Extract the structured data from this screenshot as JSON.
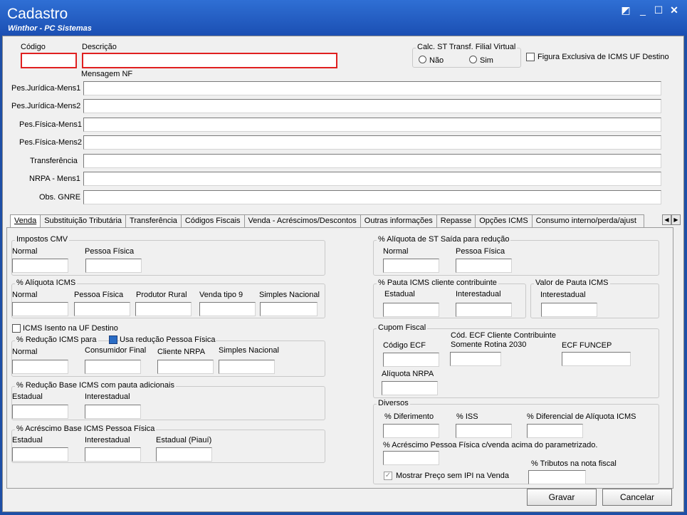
{
  "window": {
    "title": "Cadastro",
    "subtitle": "Winthor - PC Sistemas"
  },
  "top": {
    "codigo_label": "Código",
    "descricao_label": "Descrição",
    "mensagem_label": "Mensagem NF",
    "calc_group": "Calc. ST Transf. Filial Virtual",
    "radio_nao": "Não",
    "radio_sim": "Sim",
    "figura_label": "Figura Exclusiva de ICMS UF Destino",
    "fields": [
      "Pes.Jurídica-Mens1",
      "Pes.Jurídica-Mens2",
      "Pes.Física-Mens1",
      "Pes.Física-Mens2",
      "Transferência",
      "NRPA - Mens1",
      "Obs. GNRE"
    ]
  },
  "tabs": [
    "Venda",
    "Substituição Tributária",
    "Transferência",
    "Códigos Fiscais",
    "Venda - Acréscimos/Descontos",
    "Outras informações",
    "Repasse",
    "Opções ICMS",
    "Consumo interno/perda/ajust"
  ],
  "left": {
    "impostos": {
      "title": "Impostos CMV",
      "normal": "Normal",
      "pf": "Pessoa Física"
    },
    "aliq": {
      "title": "% Alíquota ICMS",
      "cols": [
        "Normal",
        "Pessoa Física",
        "Produtor Rural",
        "Venda tipo 9",
        "Simples Nacional"
      ]
    },
    "isento": "ICMS Isento na UF Destino",
    "reducao": {
      "title": "% Redução ICMS para",
      "usa": "Usa redução Pessoa Física",
      "cols": [
        "Normal",
        "Consumidor Final",
        "Cliente NRPA",
        "Simples Nacional"
      ]
    },
    "base": {
      "title": "% Redução Base ICMS com pauta adicionais",
      "cols": [
        "Estadual",
        "Interestadual"
      ]
    },
    "acres": {
      "title": "% Acréscimo Base ICMS Pessoa Física",
      "cols": [
        "Estadual",
        "Interestadual",
        "Estadual (Piauí)"
      ]
    }
  },
  "right": {
    "st": {
      "title": "% Alíquota de ST Saída para redução",
      "normal": "Normal",
      "pf": "Pessoa Física"
    },
    "pauta": {
      "title": "% Pauta ICMS cliente contribuinte",
      "estadual": "Estadual",
      "inter": "Interestadual"
    },
    "valor": {
      "title": "Valor de Pauta ICMS",
      "inter": "Interestadual"
    },
    "cupom": {
      "title": "Cupom Fiscal",
      "ecf": "Código ECF",
      "cod1": "Cód. ECF Cliente Contribuinte",
      "cod2": "Somente Rotina 2030",
      "funcep": "ECF FUNCEP",
      "nrpa": "Alíquota NRPA"
    },
    "diversos": {
      "title": "Diversos",
      "dif": "% Diferimento",
      "iss": "% ISS",
      "difal": "% Diferencial de Alíquota ICMS",
      "acres": "% Acréscimo Pessoa Física c/venda acima do parametrizado.",
      "trib": "% Tributos na nota fiscal",
      "mostrar": "Mostrar Preço sem IPI na Venda"
    }
  },
  "buttons": {
    "gravar": "Gravar",
    "cancelar": "Cancelar"
  }
}
